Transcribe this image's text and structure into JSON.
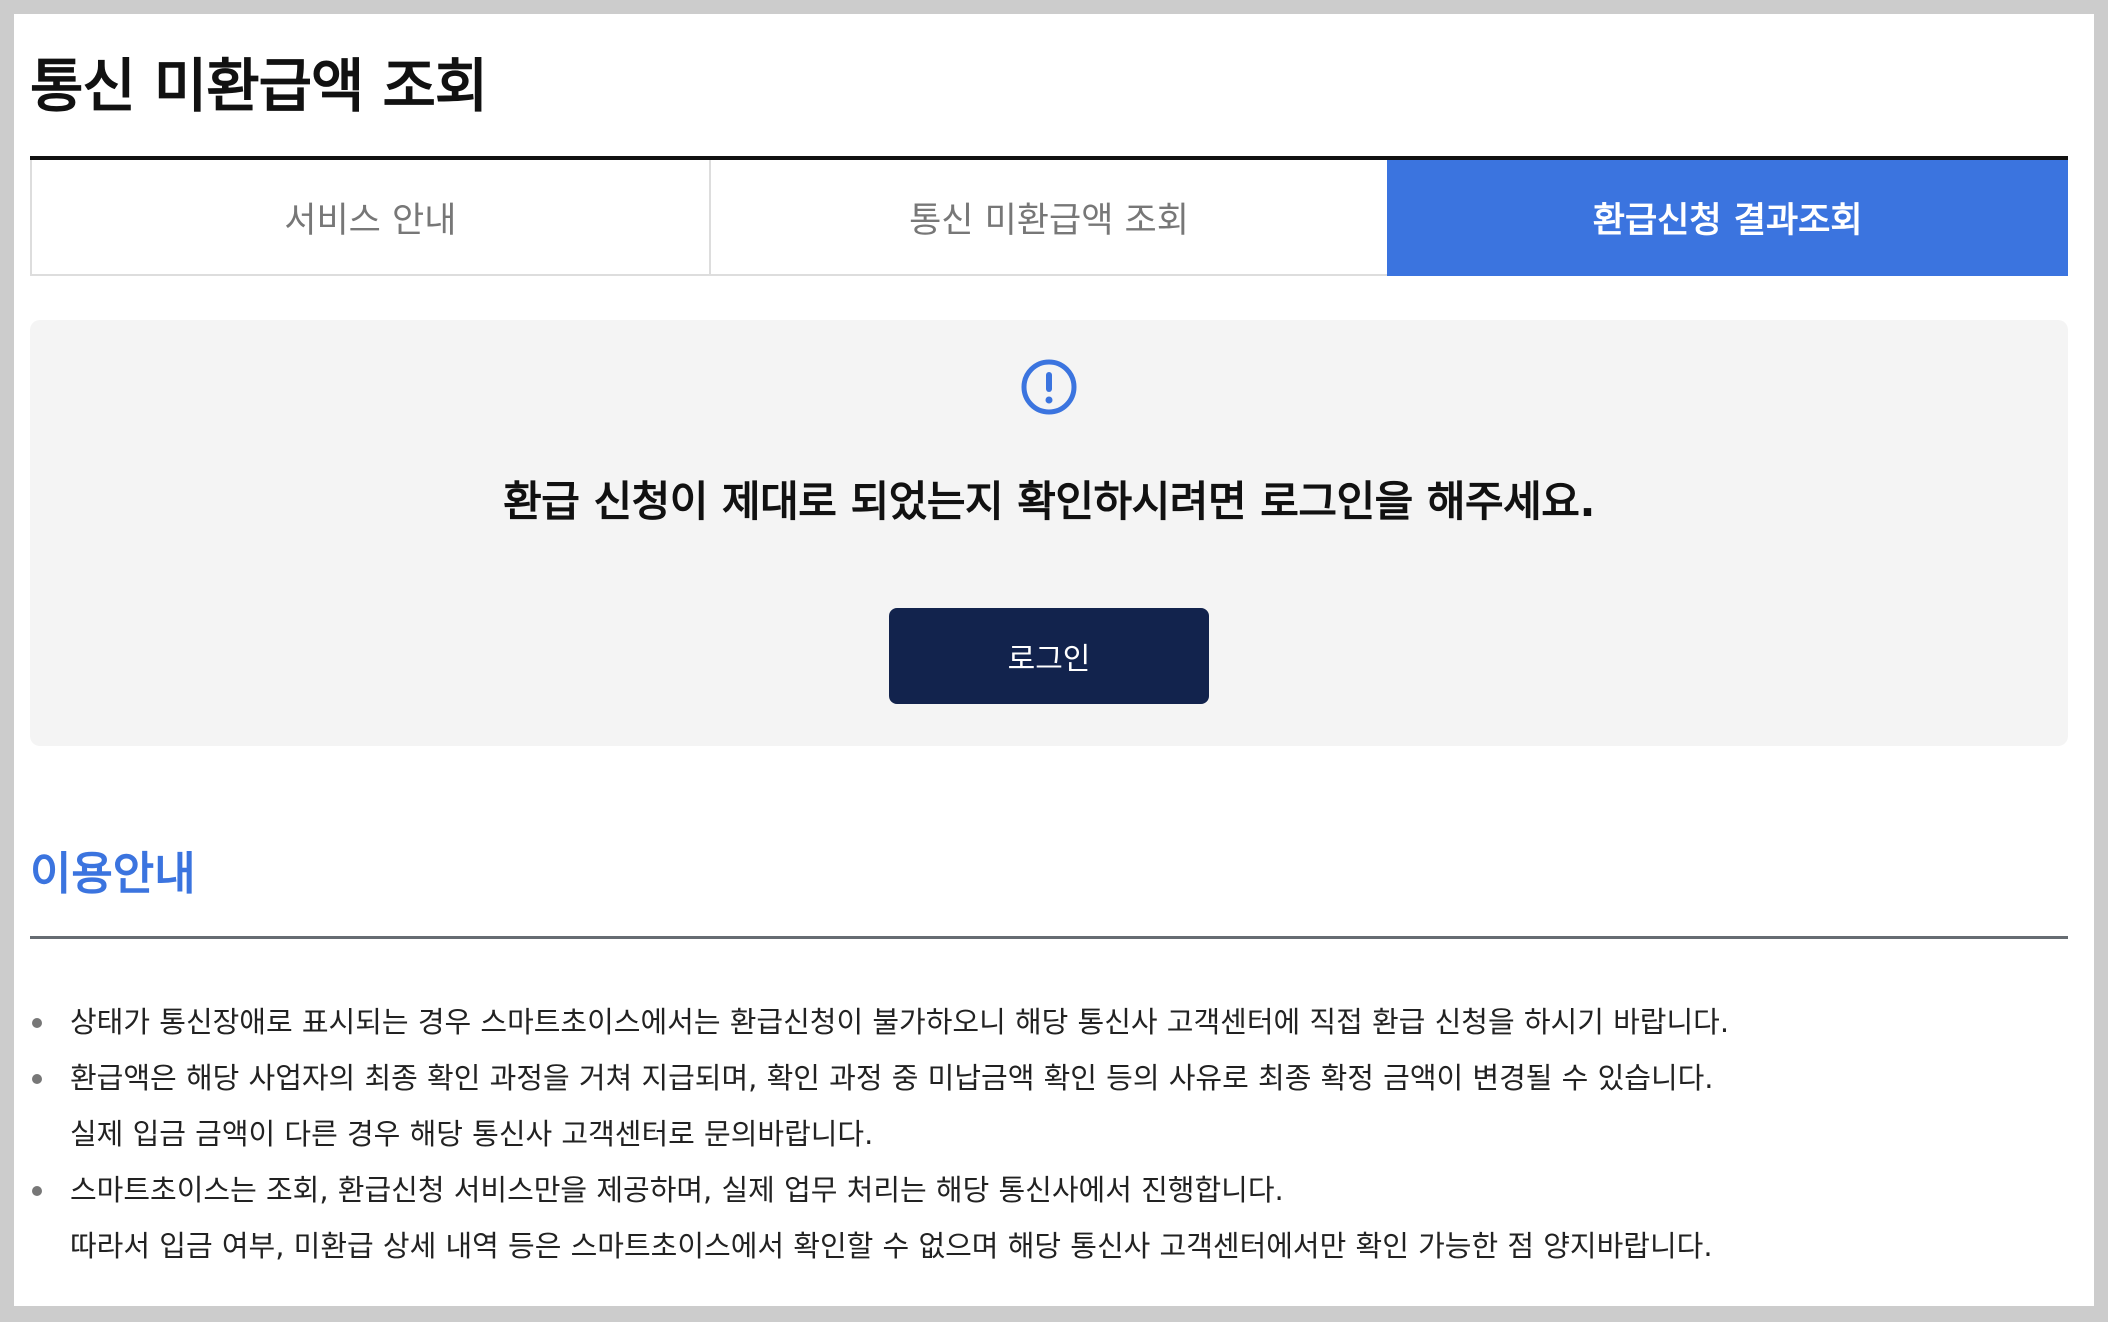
{
  "page": {
    "title": "통신 미환급액 조회"
  },
  "tabs": [
    {
      "label": "서비스 안내",
      "active": false
    },
    {
      "label": "통신 미환급액 조회",
      "active": false
    },
    {
      "label": "환급신청 결과조회",
      "active": true
    }
  ],
  "notice": {
    "icon": "exclamation-circle-icon",
    "message": "환급 신청이 제대로 되었는지 확인하시려면 로그인을 해주세요.",
    "login_label": "로그인"
  },
  "guide": {
    "title": "이용안내",
    "items": [
      {
        "lines": [
          "상태가 통신장애로 표시되는 경우 스마트초이스에서는 환급신청이 불가하오니 해당 통신사 고객센터에 직접 환급 신청을 하시기 바랍니다."
        ]
      },
      {
        "lines": [
          "환급액은 해당 사업자의 최종 확인 과정을 거쳐 지급되며, 확인 과정 중 미납금액 확인 등의 사유로 최종 확정 금액이 변경될 수 있습니다.",
          "실제 입금 금액이 다른 경우 해당 통신사 고객센터로 문의바랍니다."
        ]
      },
      {
        "lines": [
          "스마트초이스는 조회, 환급신청 서비스만을 제공하며, 실제 업무 처리는 해당 통신사에서 진행합니다.",
          "따라서 입금 여부, 미환급 상세 내역 등은 스마트초이스에서 확인할 수 없으며 해당 통신사 고객센터에서만 확인 가능한 점 양지바랍니다."
        ]
      }
    ]
  },
  "colors": {
    "accent": "#3b74df",
    "button": "#12234d",
    "panel": "#f4f4f4"
  }
}
